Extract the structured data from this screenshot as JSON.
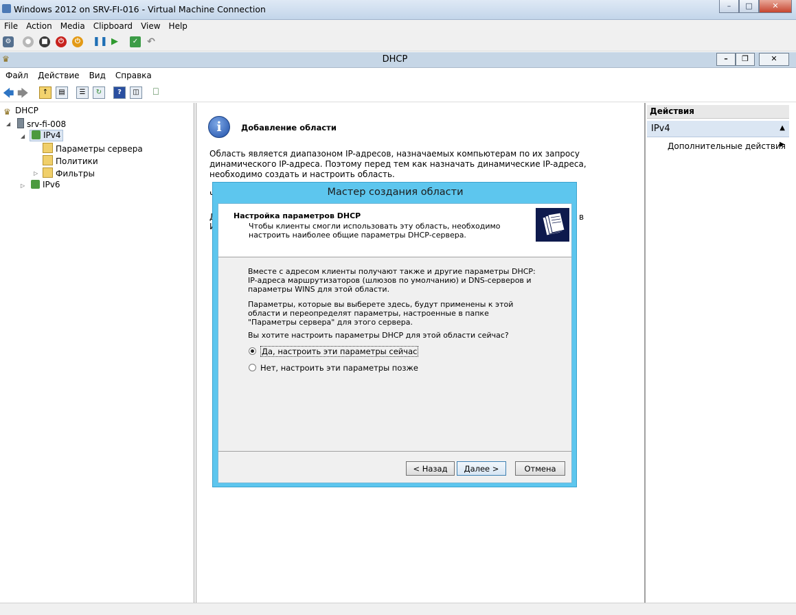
{
  "vm_window": {
    "title": "Windows 2012 on SRV-FI-016 - Virtual Machine Connection",
    "menu": [
      "File",
      "Action",
      "Media",
      "Clipboard",
      "View",
      "Help"
    ],
    "toolbar_icons": [
      "ctrl-alt-del-icon",
      "start-icon",
      "turn-off-icon",
      "shutdown-icon",
      "power-icon",
      "pause-icon",
      "resume-icon",
      "checkpoint-icon",
      "revert-icon"
    ]
  },
  "dhcp_window": {
    "title": "DHCP",
    "menu": [
      "Файл",
      "Действие",
      "Вид",
      "Справка"
    ]
  },
  "tree": {
    "root": "DHCP",
    "server": "srv-fi-008",
    "ipv4": "IPv4",
    "children": [
      "Параметры сервера",
      "Политики",
      "Фильтры"
    ],
    "ipv6": "IPv6"
  },
  "center": {
    "title": "Добавление области",
    "description": "Область является диапазоном IP-адресов, назначаемых компьютерам по их запросу динамического IP-адреса. Поэтому перед тем как назначать динамические IP-адреса, необходимо создать и настроить область.",
    "trunc1": "Ч",
    "trunc2": "Д",
    "trunc3": "И",
    "trunc4": "в"
  },
  "actions": {
    "header": "Действия",
    "section": "IPv4",
    "more": "Дополнительные действия"
  },
  "wizard": {
    "title": "Мастер создания области",
    "header_title": "Настройка параметров DHCP",
    "header_subtitle": "Чтобы клиенты смогли использовать эту область, необходимо настроить наиболее общие параметры DHCP-сервера.",
    "para1": "Вместе с адресом клиенты получают также и другие параметры DHCP: IP-адреса маршрутизаторов (шлюзов по умолчанию) и DNS-серверов и параметры WINS для этой области.",
    "para2": "Параметры, которые вы выберете здесь, будут применены к этой области и переопределят параметры, настроенные в папке \"Параметры сервера\" для этого сервера.",
    "question": "Вы хотите настроить параметры DHCP для этой области сейчас?",
    "option_yes": "Да, настроить эти параметры сейчас",
    "option_no": "Нет, настроить эти параметры позже",
    "selected": "yes",
    "btn_back": "< Назад",
    "btn_next": "Далее >",
    "btn_cancel": "Отмена"
  },
  "colors": {
    "wizard_frame": "#5dc6ee",
    "dhcp_titlebar": "#c6d6e6",
    "actions_section": "#dbe6f3"
  }
}
